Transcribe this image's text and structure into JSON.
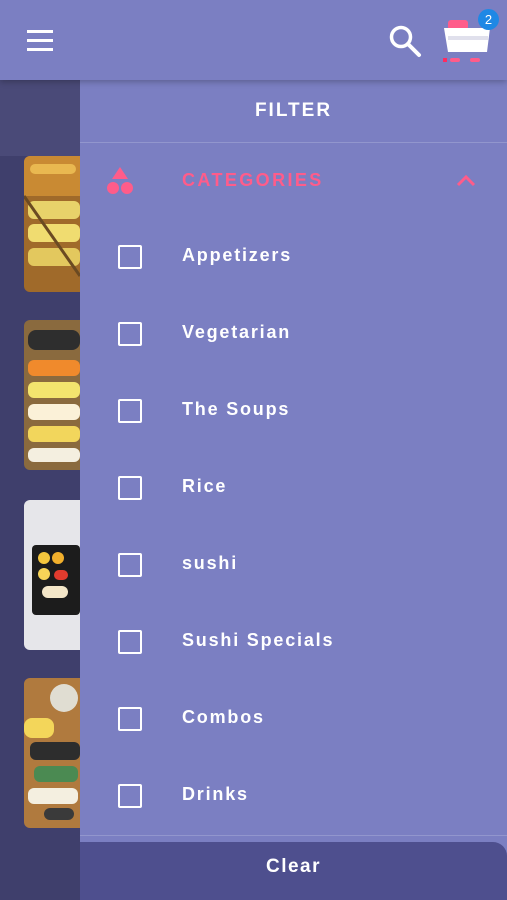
{
  "appbar": {
    "menu_icon": "hamburger-menu-icon",
    "search_icon": "search-icon",
    "cart_icon": "cart-icon",
    "cart_count": "2",
    "colors": {
      "bar": "#7b7fc2",
      "badge": "#1e88e5"
    }
  },
  "drawer": {
    "title": "FILTER",
    "category_header": {
      "label": "CATEGORIES",
      "icon": "shapes-icon",
      "chevron": "chevron-up-icon",
      "accent": "#ff5c8a"
    },
    "items": [
      {
        "label": "Appetizers",
        "checked": false
      },
      {
        "label": "Vegetarian",
        "checked": false
      },
      {
        "label": "The Soups",
        "checked": false
      },
      {
        "label": "Rice",
        "checked": false
      },
      {
        "label": "sushi",
        "checked": false
      },
      {
        "label": "Sushi Specials",
        "checked": false
      },
      {
        "label": "Combos",
        "checked": false
      },
      {
        "label": "Drinks",
        "checked": false
      }
    ],
    "clear_label": "Clear"
  }
}
